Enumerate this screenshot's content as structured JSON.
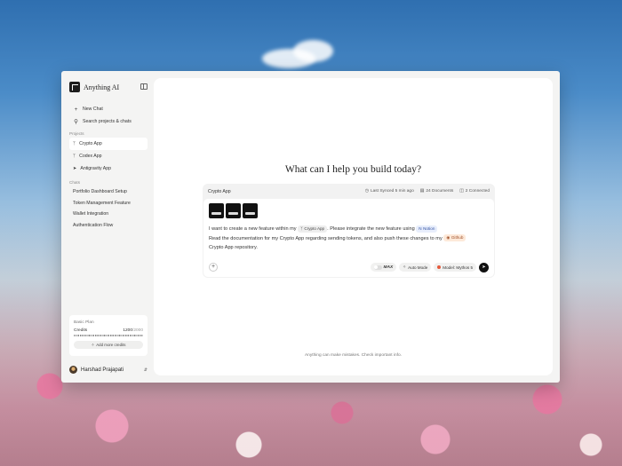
{
  "app": {
    "name": "Anything AI"
  },
  "sidebar": {
    "new_chat": "New Chat",
    "search": "Search projects & chats",
    "projects_label": "Projects",
    "projects": [
      {
        "label": "Crypto App",
        "icon": "network-icon",
        "active": true
      },
      {
        "label": "Codex App",
        "icon": "network-icon",
        "active": false
      },
      {
        "label": "Antigravity App",
        "icon": "antigravity-icon",
        "active": false
      }
    ],
    "chats_label": "Chats",
    "chats": [
      {
        "label": "Portfolio Dashboard Setup"
      },
      {
        "label": "Token Management Feature"
      },
      {
        "label": "Wallet Integration"
      },
      {
        "label": "Authentication Flow"
      }
    ],
    "plan": {
      "name": "Basic Plan",
      "credits_label": "Credits",
      "credits_used": "1200",
      "credits_total": "/2000",
      "credits_fraction": 0.6,
      "add_credits": "Add more credits"
    },
    "user": {
      "name": "Harshad Prajapati"
    }
  },
  "main": {
    "headline": "What can I help you build today?",
    "composer": {
      "project": "Crypto App",
      "last_synced": "Last Synced 5 min ago",
      "documents": "24 Documents",
      "connected": "2 Connected",
      "prompt": {
        "part1": "I want to create a new feature within my",
        "chip_crypto": "Crypto App",
        "part2": ". Please integrate the new feature using",
        "chip_notion": "Notion",
        "part3": "Read the documentation for my Crypto App regarding sending tokens, and also push these changes to my",
        "chip_github": "Github",
        "part4": "Crypto App repository."
      },
      "max_label": "MAX",
      "auto_mode": "Auto Mode",
      "model": "Model: Mythos 5"
    },
    "disclaimer": "Anything can make mistakes. Check important info."
  }
}
